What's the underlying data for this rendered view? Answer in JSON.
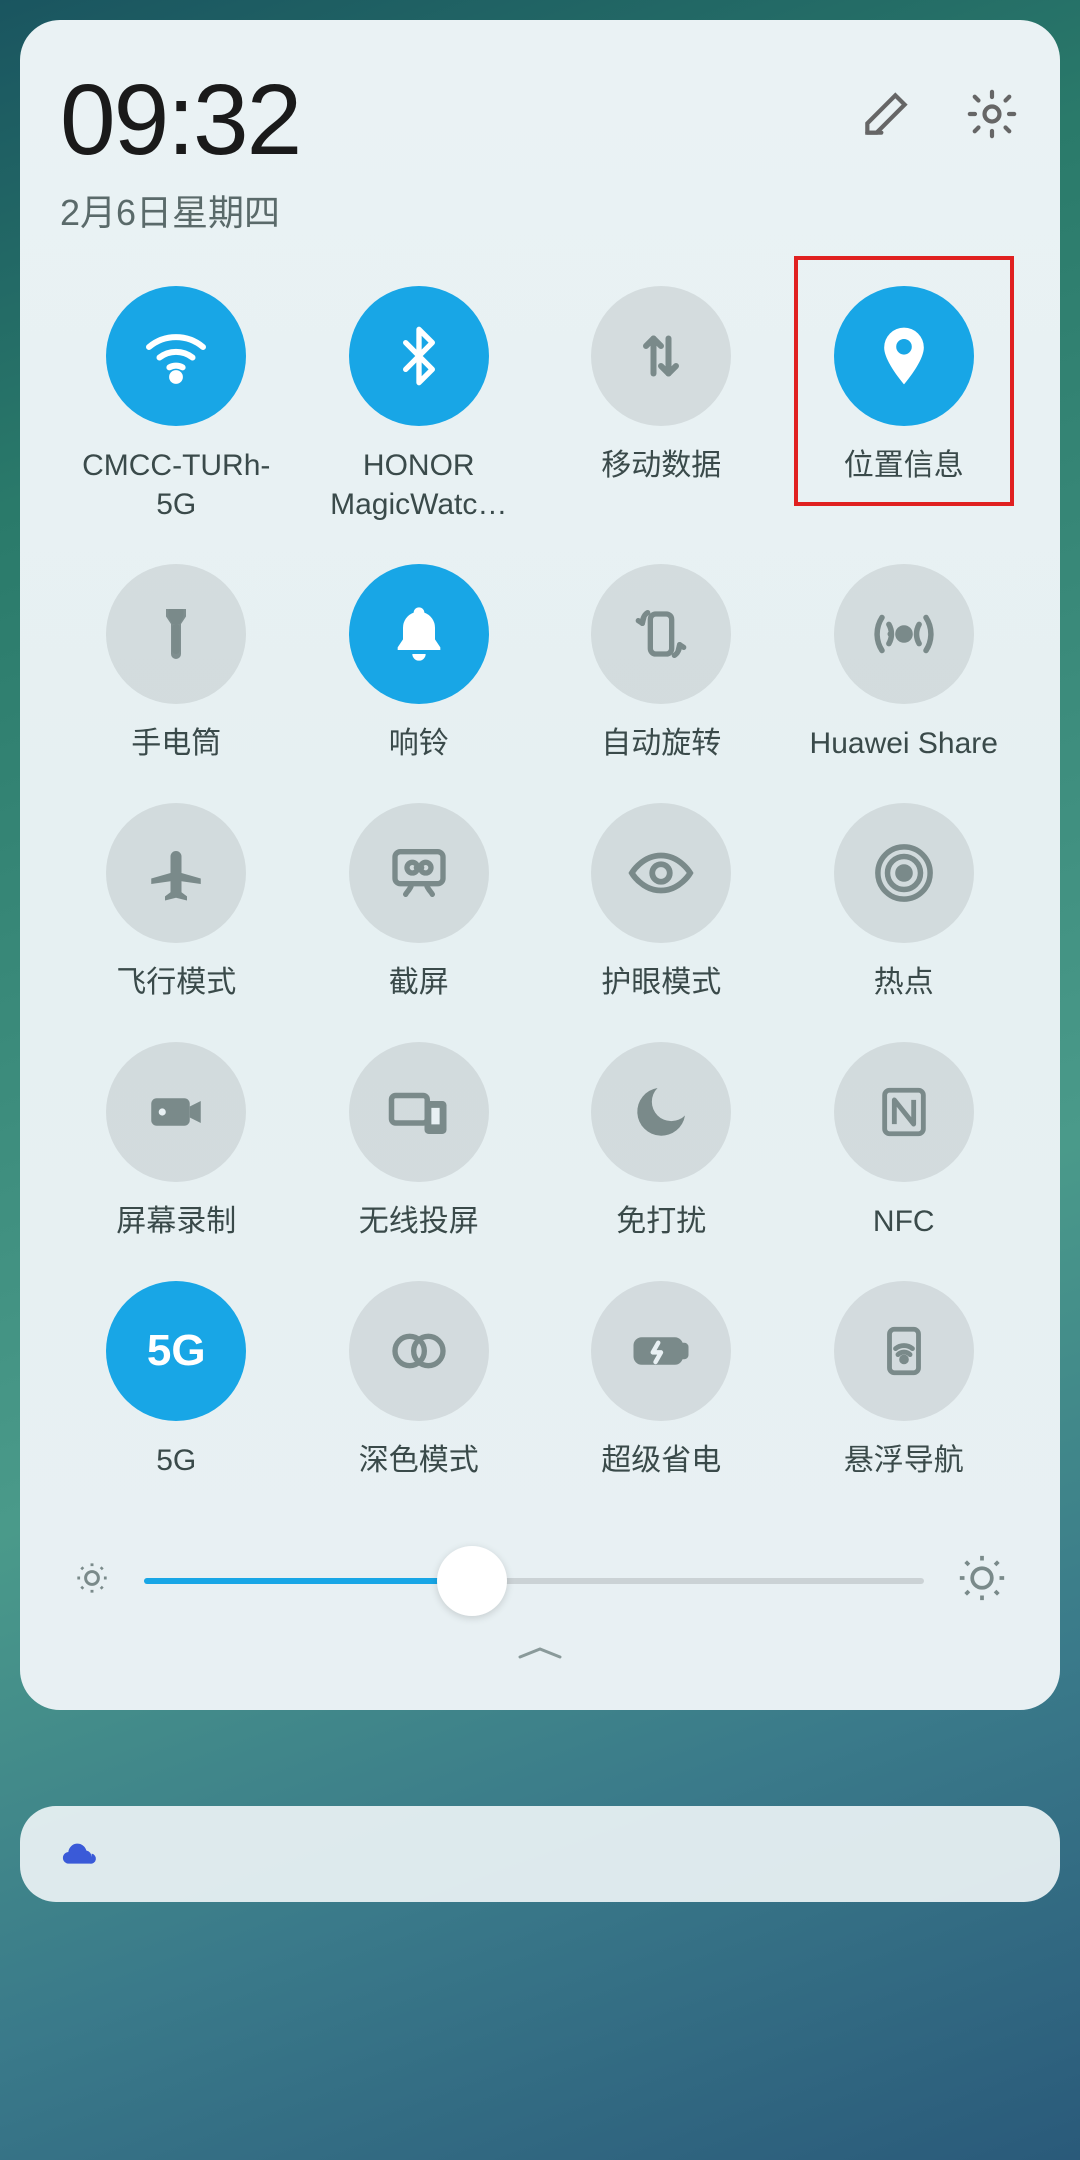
{
  "header": {
    "time": "09:32",
    "date": "2月6日星期四"
  },
  "tiles": [
    {
      "id": "wifi",
      "label": "CMCC-TURh-5G",
      "active": true
    },
    {
      "id": "bluetooth",
      "label": "HONOR MagicWatc…",
      "active": true
    },
    {
      "id": "mobile-data",
      "label": "移动数据",
      "active": false
    },
    {
      "id": "location",
      "label": "位置信息",
      "active": true,
      "highlighted": true
    },
    {
      "id": "flashlight",
      "label": "手电筒",
      "active": false
    },
    {
      "id": "ring",
      "label": "响铃",
      "active": true
    },
    {
      "id": "auto-rotate",
      "label": "自动旋转",
      "active": false
    },
    {
      "id": "huawei-share",
      "label": "Huawei Share",
      "active": false
    },
    {
      "id": "airplane",
      "label": "飞行模式",
      "active": false
    },
    {
      "id": "screenshot",
      "label": "截屏",
      "active": false
    },
    {
      "id": "eye-comfort",
      "label": "护眼模式",
      "active": false
    },
    {
      "id": "hotspot",
      "label": "热点",
      "active": false
    },
    {
      "id": "screen-record",
      "label": "屏幕录制",
      "active": false
    },
    {
      "id": "wireless-proj",
      "label": "无线投屏",
      "active": false
    },
    {
      "id": "dnd",
      "label": "免打扰",
      "active": false
    },
    {
      "id": "nfc",
      "label": "NFC",
      "active": false
    },
    {
      "id": "5g",
      "label": "5G",
      "active": true,
      "text_icon": "5G"
    },
    {
      "id": "dark-mode",
      "label": "深色模式",
      "active": false
    },
    {
      "id": "power-save",
      "label": "超级省电",
      "active": false
    },
    {
      "id": "floating-nav",
      "label": "悬浮导航",
      "active": false
    }
  ],
  "brightness": {
    "value": 42
  },
  "colors": {
    "accent": "#18a6e6",
    "highlight_border": "#e02020",
    "icon_off": "#7a8a8a"
  }
}
